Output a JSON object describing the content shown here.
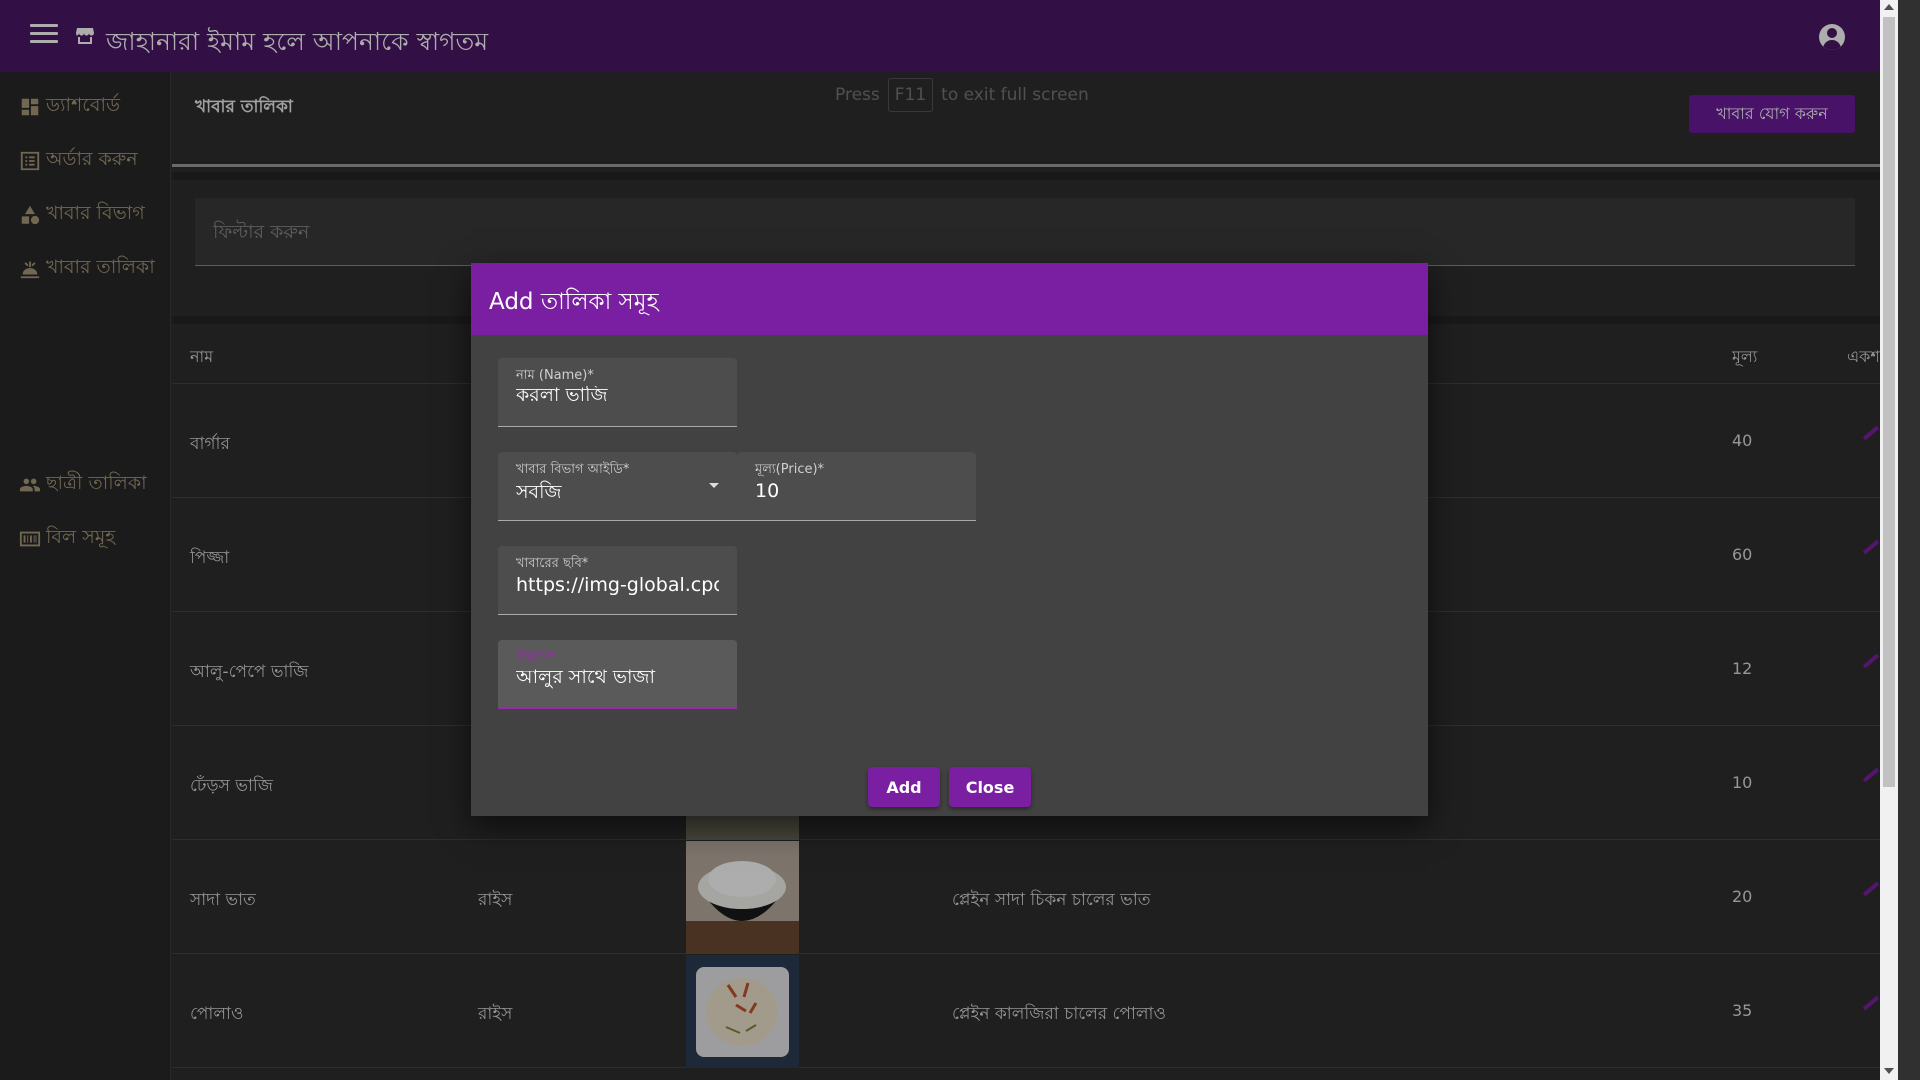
{
  "header": {
    "title": "জাহানারা ইমাম হলে আপনাকে স্বাগতম",
    "menu_icon": "menu-icon",
    "store_icon": "store-icon",
    "account_icon": "account-circle-icon"
  },
  "sidebar": {
    "items": [
      {
        "label": "ড্যাশবোর্ড",
        "icon": "dashboard-icon"
      },
      {
        "label": "অর্ডার করুন",
        "icon": "list-icon"
      },
      {
        "label": "খাবার বিভাগ",
        "icon": "category-icon"
      },
      {
        "label": "খাবার তালিকা",
        "icon": "food-list-icon"
      },
      {
        "label": "ছাত্রী তালিকা",
        "icon": "people-icon"
      },
      {
        "label": "বিল সমূহ",
        "icon": "billing-icon"
      }
    ]
  },
  "main": {
    "title": "খাবার তালিকা",
    "add_button": "খাবার যোগ করুন",
    "filter_placeholder": "ফিল্টার করুন",
    "fullscreen_hint": {
      "press": "Press",
      "key": "F11",
      "rest": "to exit full screen"
    },
    "table": {
      "headers": {
        "name": "নাম",
        "price": "মূল্য",
        "action": "একশ"
      },
      "rows": [
        {
          "name": "বার্গার",
          "category": "",
          "description": "",
          "price": "40"
        },
        {
          "name": "পিজ্জা",
          "category": "",
          "description": "",
          "price": "60"
        },
        {
          "name": "আলু-পেপে ভাজি",
          "category": "",
          "description": "",
          "price": "12"
        },
        {
          "name": "ঢেঁড়স ভাজি",
          "category": "",
          "description": "",
          "price": "10"
        },
        {
          "name": "সাদা ভাত",
          "category": "রাইস",
          "description": "প্লেইন সাদা চিকন চালের ভাত",
          "price": "20"
        },
        {
          "name": "পোলাও",
          "category": "রাইস",
          "description": "প্লেইন কালজিরা চালের পোলাও",
          "price": "35"
        }
      ]
    }
  },
  "dialog": {
    "title": "Add তালিকা সমূহ",
    "name_label": "নাম (Name)*",
    "name_value": "করলা ভাজি",
    "category_label": "খাবার বিভাগ আইডি*",
    "category_value": "সবজি",
    "price_label": "মূল্য(Price)*",
    "price_value": "10",
    "image_label": "খাবারের ছবি*",
    "image_value": "https://img-global.cpcdn.com",
    "desc_label": "বিবরণ*",
    "desc_value": "আলুর সাথে ভাজা",
    "add_button": "Add",
    "close_button": "Close"
  },
  "colors": {
    "topbar": "#4a1765",
    "accent": "#7b1fa2",
    "sidebar_text": "#a99a7a"
  }
}
